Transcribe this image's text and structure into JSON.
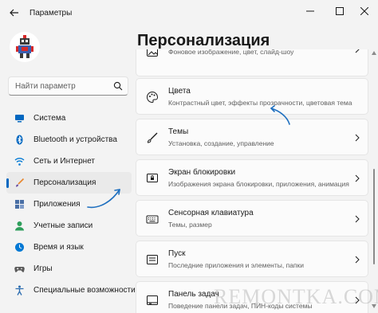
{
  "window": {
    "title": "Параметры",
    "controls": [
      "minimize-icon",
      "maximize-icon",
      "close-icon"
    ]
  },
  "search": {
    "placeholder": "Найти параметр"
  },
  "sidebar": {
    "items": [
      {
        "label": "Система",
        "icon": "system-icon",
        "color": "#0067c0"
      },
      {
        "label": "Bluetooth и устройства",
        "icon": "bluetooth-icon",
        "color": "#0067c0"
      },
      {
        "label": "Сеть и Интернет",
        "icon": "wifi-icon",
        "color": "#0078d4"
      },
      {
        "label": "Персонализация",
        "icon": "brush-icon",
        "color": "#e8862c",
        "active": true
      },
      {
        "label": "Приложения",
        "icon": "apps-icon",
        "color": "#4a6fa5"
      },
      {
        "label": "Учетные записи",
        "icon": "account-icon",
        "color": "#2e9e5b"
      },
      {
        "label": "Время и язык",
        "icon": "globe-clock-icon",
        "color": "#0078d4"
      },
      {
        "label": "Игры",
        "icon": "gamepad-icon",
        "color": "#5a5a5a"
      },
      {
        "label": "Специальные возможности",
        "icon": "accessibility-icon",
        "color": "#2b6cb0"
      }
    ]
  },
  "main": {
    "title": "Персонализация",
    "cards": [
      {
        "subtitle": "Фоновое изображение, цвет, слайд-шоу",
        "icon": "image-icon",
        "partial": true
      },
      {
        "title": "Цвета",
        "subtitle": "Контрастный цвет, эффекты прозрачности, цветовая тема",
        "icon": "palette-icon"
      },
      {
        "title": "Темы",
        "subtitle": "Установка, создание, управление",
        "icon": "brush-icon"
      },
      {
        "title": "Экран блокировки",
        "subtitle": "Изображения экрана блокировки, приложения, анимация",
        "icon": "lock-screen-icon"
      },
      {
        "title": "Сенсорная клавиатура",
        "subtitle": "Темы, размер",
        "icon": "keyboard-icon"
      },
      {
        "title": "Пуск",
        "subtitle": "Последние приложения и элементы, папки",
        "icon": "start-menu-icon"
      },
      {
        "title": "Панель задач",
        "subtitle": "Поведение панели задач, ПИН-коды системы",
        "icon": "taskbar-icon"
      }
    ]
  },
  "watermark": "REMONTKA.COM",
  "colors": {
    "accent": "#0067c0",
    "arrow": "#1e6fbf",
    "background": "#f3f3f3",
    "card": "#fbfbfb"
  }
}
